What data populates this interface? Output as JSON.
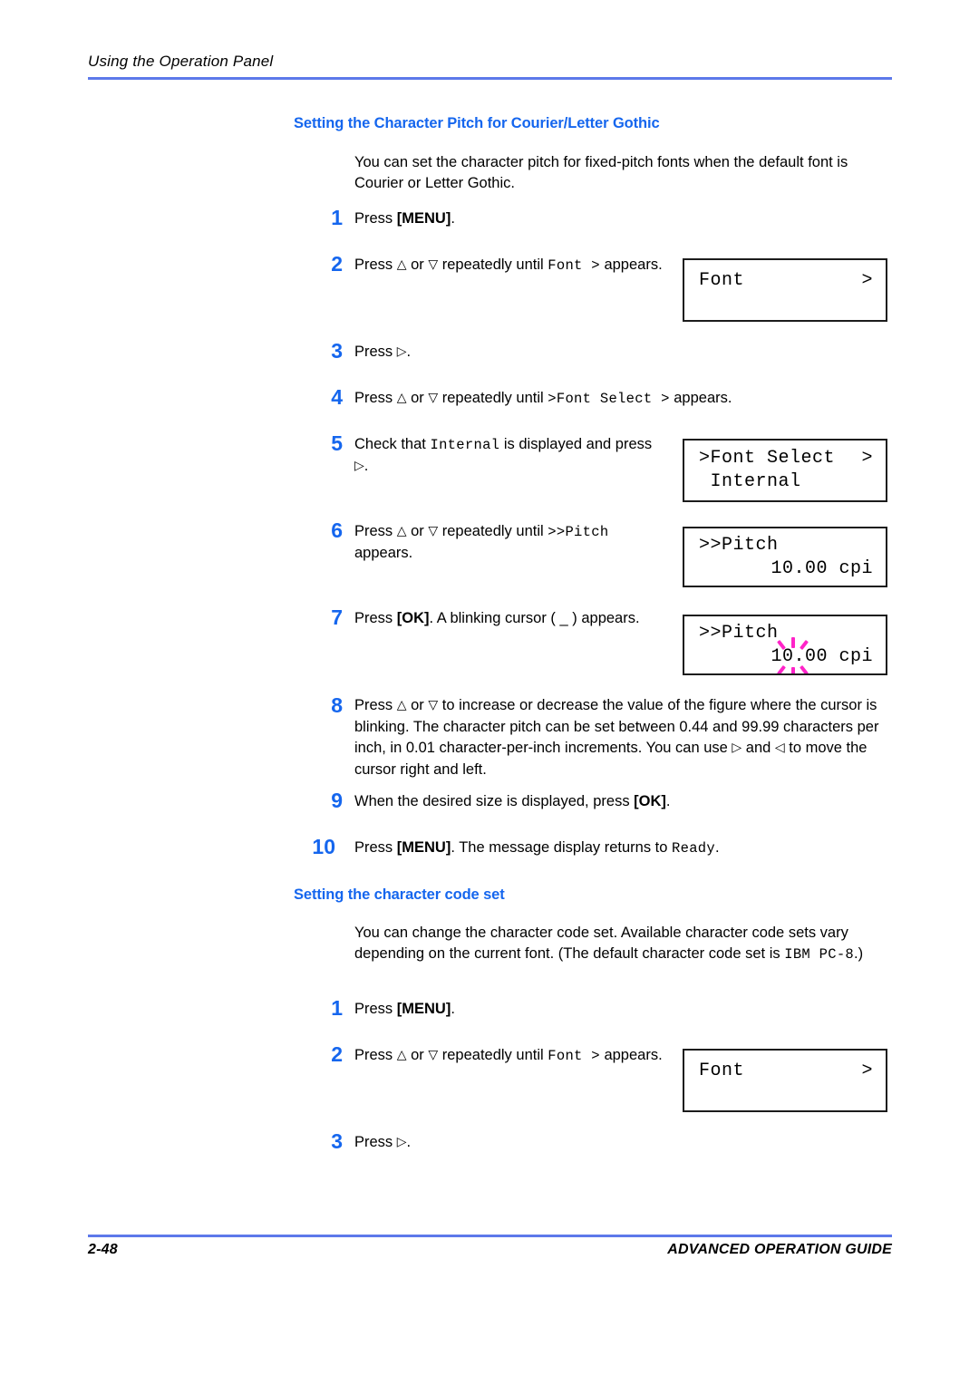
{
  "header": {
    "running_head": "Using the Operation Panel"
  },
  "footer": {
    "page_number": "2-48",
    "guide_title": "ADVANCED OPERATION GUIDE"
  },
  "colors": {
    "heading_blue": "#1566ee",
    "rule_blue": "#5d79ea",
    "step_number_blue": "#1566ee",
    "blink_magenta": "#ff23c8",
    "lcd_border": "#1c1c1c",
    "body_text": "#000000"
  },
  "sections": [
    {
      "heading": "Setting the Character Pitch for Courier/Letter Gothic",
      "intro": "You can set the character pitch for fixed-pitch fonts when the default font is Courier or Letter Gothic.",
      "steps": [
        {
          "number": "1",
          "text": "Press [MENU]."
        },
        {
          "number": "2",
          "text": "Press △ or ▽ repeatedly until Font > appears."
        },
        {
          "number": "3",
          "text": "Press ▷."
        },
        {
          "number": "4",
          "text": "Press △ or ▽ repeatedly until >Font Select > appears."
        },
        {
          "number": "5",
          "text": "Check that Internal is displayed and press ▷."
        },
        {
          "number": "6",
          "text": "Press △ or ▽ repeatedly until >>Pitch appears."
        },
        {
          "number": "7",
          "text": "Press [OK]. A blinking cursor ( _ ) appears."
        },
        {
          "number": "8",
          "text": "Press △ or ▽ to increase or decrease the value of the figure where the cursor is blinking. The character pitch can be set between 0.44 and 99.99 characters per inch, in 0.01 character-per-inch increments. You can use ▷ and ◁ to move the cursor right and left."
        },
        {
          "number": "9",
          "text": "When the desired size is displayed, press [OK]."
        },
        {
          "number": "10",
          "text": "Press [MENU]. The message display returns to Ready."
        }
      ]
    },
    {
      "heading": "Setting the character code set",
      "intro": "You can change the character code set. Available character code sets vary depending on the current font. (The default character code set is IBM PC-8.)",
      "steps": [
        {
          "number": "1",
          "text": "Press [MENU]."
        },
        {
          "number": "2",
          "text": "Press △ or ▽ repeatedly until Font > appears."
        },
        {
          "number": "3",
          "text": "Press ▷."
        }
      ]
    }
  ],
  "lcd_panels": [
    {
      "id": "lcd-font-step2",
      "line1_left": "Font",
      "line1_right": ">",
      "line2_left": "",
      "line2_right": ""
    },
    {
      "id": "lcd-font-select",
      "line1_left": ">Font Select",
      "line1_right": ">",
      "line2_left": " Internal",
      "line2_right": ""
    },
    {
      "id": "lcd-pitch",
      "line1_left": ">>Pitch",
      "line1_right": "",
      "line2_left": "",
      "line2_right": "10.00 cpi"
    },
    {
      "id": "lcd-pitch-blinking",
      "line1_left": ">>Pitch",
      "line1_right": "",
      "line2_left": "",
      "line2_right": "10.00 cpi"
    },
    {
      "id": "lcd-font-step2b",
      "line1_left": "Font",
      "line1_right": ">",
      "line2_left": "",
      "line2_right": ""
    }
  ],
  "inline_code": {
    "font_arrow": "Font >",
    "font_select_arrow": ">Font Select >",
    "pitch": ">>Pitch",
    "internal": "Internal",
    "ready": "Ready",
    "ibm_pc8": "IBM PC-8",
    "menu_key": "[MENU]",
    "ok_key": "[OK]"
  },
  "icons": {
    "up_triangle": "△",
    "down_triangle": "▽",
    "right_triangle": "▷",
    "left_triangle": "◁",
    "blink_starburst": "blink-starburst-icon"
  }
}
